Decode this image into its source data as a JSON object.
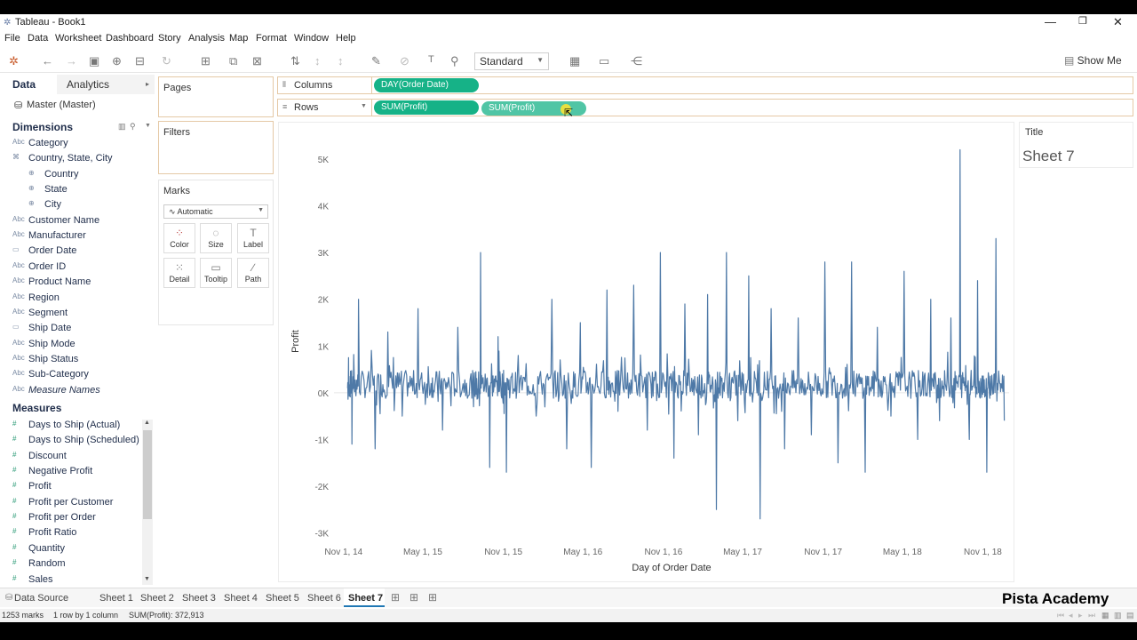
{
  "window": {
    "title": "Tableau - Book1"
  },
  "menu": [
    "File",
    "Data",
    "Worksheet",
    "Dashboard",
    "Story",
    "Analysis",
    "Map",
    "Format",
    "Window",
    "Help"
  ],
  "toolbar": {
    "fit": "Standard",
    "show_me": "Show Me"
  },
  "data_pane": {
    "tab_data": "Data",
    "tab_analytics": "Analytics",
    "datasource": "Master (Master)",
    "dimensions_header": "Dimensions",
    "measures_header": "Measures",
    "dimensions": [
      {
        "name": "Category",
        "icon": "Abc"
      },
      {
        "name": "Country, State, City",
        "icon": "hierarchy"
      },
      {
        "name": "Country",
        "icon": "globe"
      },
      {
        "name": "State",
        "icon": "globe"
      },
      {
        "name": "City",
        "icon": "globe"
      },
      {
        "name": "Customer Name",
        "icon": "Abc"
      },
      {
        "name": "Manufacturer",
        "icon": "Abc"
      },
      {
        "name": "Order Date",
        "icon": "date"
      },
      {
        "name": "Order ID",
        "icon": "Abc"
      },
      {
        "name": "Product Name",
        "icon": "Abc"
      },
      {
        "name": "Region",
        "icon": "Abc"
      },
      {
        "name": "Segment",
        "icon": "Abc"
      },
      {
        "name": "Ship Date",
        "icon": "date"
      },
      {
        "name": "Ship Mode",
        "icon": "Abc"
      },
      {
        "name": "Ship Status",
        "icon": "Abc"
      },
      {
        "name": "Sub-Category",
        "icon": "Abc"
      },
      {
        "name": "Measure Names",
        "icon": "Abc"
      }
    ],
    "measures": [
      "Days to Ship (Actual)",
      "Days to Ship (Scheduled)",
      "Discount",
      "Negative Profit",
      "Profit",
      "Profit per Customer",
      "Profit per Order",
      "Profit Ratio",
      "Quantity",
      "Random",
      "Sales"
    ]
  },
  "cards": {
    "pages": "Pages",
    "filters": "Filters",
    "marks": "Marks",
    "mark_type": "Automatic",
    "buttons": [
      "Color",
      "Size",
      "Label",
      "Detail",
      "Tooltip",
      "Path"
    ]
  },
  "shelves": {
    "columns_label": "Columns",
    "rows_label": "Rows",
    "columns_pill": "DAY(Order Date)",
    "rows_pills": [
      "SUM(Profit)",
      "SUM(Profit)"
    ]
  },
  "title_card": {
    "label": "Title",
    "value": "Sheet 7"
  },
  "tabs": {
    "data_source": "Data Source",
    "sheets": [
      "Sheet 1",
      "Sheet 2",
      "Sheet 3",
      "Sheet 4",
      "Sheet 5",
      "Sheet 6",
      "Sheet 7"
    ],
    "active": "Sheet 7"
  },
  "status": {
    "marks": "1253 marks",
    "dims": "1 row by 1 column",
    "sum": "SUM(Profit): 372,913"
  },
  "watermark": "Pista Academy",
  "chart_data": {
    "type": "line",
    "xlabel": "Day of Order Date",
    "ylabel": "Profit",
    "x_ticks": [
      "Nov 1, 14",
      "May 1, 15",
      "Nov 1, 15",
      "May 1, 16",
      "Nov 1, 16",
      "May 1, 17",
      "Nov 1, 17",
      "May 1, 18",
      "Nov 1, 18"
    ],
    "y_ticks": [
      "5K",
      "4K",
      "3K",
      "2K",
      "1K",
      "0K",
      "-1K",
      "-2K",
      "-3K"
    ],
    "ylim": [
      -3200,
      5400
    ],
    "series": [
      {
        "color": "#4e79a7",
        "x": [
          "2014-11-10",
          "2014-11-20",
          "2014-12-05",
          "2015-01-12",
          "2015-02-10",
          "2015-03-15",
          "2015-04-20",
          "2015-05-20",
          "2015-06-15",
          "2015-07-20",
          "2015-08-25",
          "2015-09-10",
          "2015-10-01",
          "2015-10-20",
          "2015-11-08",
          "2015-12-05",
          "2016-01-15",
          "2016-02-20",
          "2016-03-25",
          "2016-04-25",
          "2016-05-20",
          "2016-06-25",
          "2016-07-20",
          "2016-08-25",
          "2016-09-25",
          "2016-10-25",
          "2016-11-25",
          "2016-12-20",
          "2017-01-20",
          "2017-02-10",
          "2017-03-02",
          "2017-03-25",
          "2017-04-20",
          "2017-05-15",
          "2017-06-10",
          "2017-07-05",
          "2017-08-05",
          "2017-09-05",
          "2017-10-05",
          "2017-11-05",
          "2017-12-05",
          "2018-01-05",
          "2018-02-05",
          "2018-03-05",
          "2018-04-05",
          "2018-05-05",
          "2018-06-05",
          "2018-07-05",
          "2018-07-25",
          "2018-08-20",
          "2018-09-10",
          "2018-10-01",
          "2018-10-20",
          "2018-11-10",
          "2018-12-01",
          "2018-12-20"
        ],
        "y": [
          100,
          -1100,
          2000,
          -1200,
          1300,
          -500,
          1800,
          200,
          -800,
          1400,
          -300,
          3000,
          -1600,
          1200,
          -1700,
          800,
          -500,
          2000,
          -1200,
          1500,
          -1600,
          2200,
          -400,
          2300,
          -800,
          3000,
          -1400,
          1900,
          -900,
          2100,
          -2500,
          3000,
          -600,
          2500,
          -2700,
          1800,
          -1200,
          1600,
          -900,
          2800,
          -1500,
          2800,
          -1700,
          1400,
          -500,
          2600,
          -1000,
          2000,
          -600,
          1600,
          5200,
          -1000,
          2400,
          -1700,
          3300,
          -600
        ]
      }
    ]
  }
}
